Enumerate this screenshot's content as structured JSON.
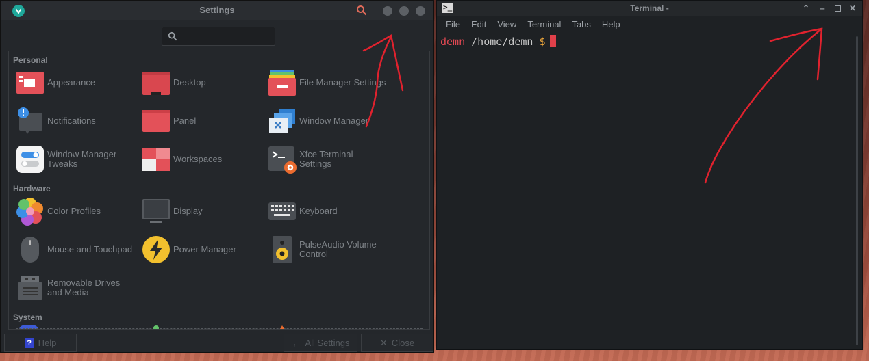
{
  "settings": {
    "title": "Settings",
    "search_placeholder": "",
    "sections": {
      "personal": "Personal",
      "hardware": "Hardware",
      "system": "System"
    },
    "items": {
      "appearance": "Appearance",
      "desktop": "Desktop",
      "file_manager": "File Manager Settings",
      "notifications": "Notifications",
      "panel": "Panel",
      "window_manager": "Window Manager",
      "wm_tweaks": "Window Manager\nTweaks",
      "workspaces": "Workspaces",
      "xfce_terminal": "Xfce Terminal\nSettings",
      "color_profiles": "Color Profiles",
      "display": "Display",
      "keyboard": "Keyboard",
      "mouse": "Mouse and Touchpad",
      "power": "Power Manager",
      "pulseaudio": "PulseAudio Volume\nControl",
      "removable": "Removable Drives\nand Media"
    },
    "buttons": {
      "help": "Help",
      "all_settings": "All Settings",
      "close": "Close"
    }
  },
  "terminal": {
    "title": "Terminal -",
    "menu": [
      "File",
      "Edit",
      "View",
      "Terminal",
      "Tabs",
      "Help"
    ],
    "prompt": {
      "user": "demn",
      "path": "/home/demn",
      "sign": "$"
    }
  },
  "colors": {
    "accent_red": "#e04852",
    "annotation": "#e0222e",
    "bg_dark": "#24272b"
  }
}
